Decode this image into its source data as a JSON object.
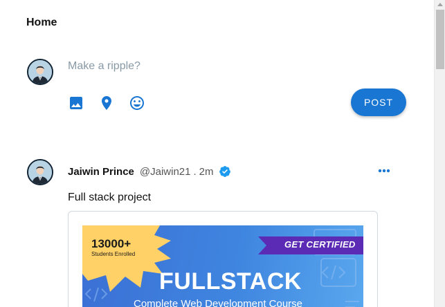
{
  "header": {
    "title": "Home"
  },
  "composer": {
    "placeholder": "Make a ripple?",
    "post_label": "POST",
    "icons": [
      "image-icon",
      "location-icon",
      "emoji-icon"
    ],
    "accent": "#1976d2"
  },
  "post": {
    "display_name": "Jaiwin Prince",
    "handle": "@Jaiwin21",
    "separator": ".",
    "time": "2m",
    "verified": true,
    "text": "Full stack project",
    "media": {
      "badge_count": "13000+",
      "badge_sub": "Students Enrolled",
      "ribbon": "GET CERTIFIED",
      "title": "FULLSTACK",
      "subtitle": "Complete Web Development Course"
    }
  },
  "colors": {
    "accent": "#1976d2",
    "verified": "#1d9bf0",
    "banner": "#3f86e0",
    "badge": "#ffd166",
    "ribbon": "#5b2bb5"
  }
}
